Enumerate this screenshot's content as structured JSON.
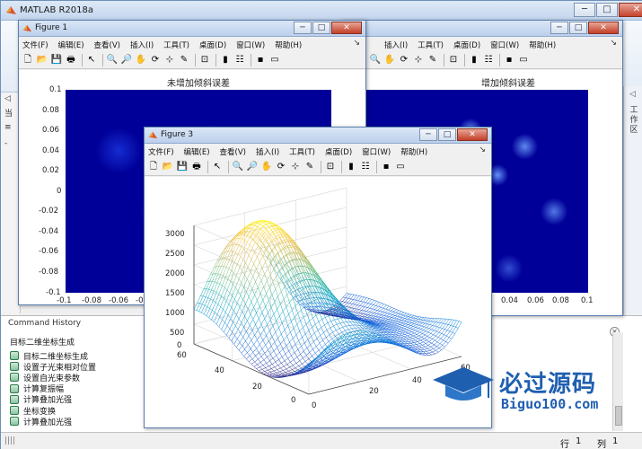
{
  "app": {
    "title": "MATLAB R2018a",
    "window_controls": {
      "minimize": "─",
      "maximize": "□",
      "close": "✕"
    }
  },
  "left_panel": {
    "glyphs": [
      "◁",
      "当",
      "≡",
      "-"
    ]
  },
  "right_panel": {
    "arrow": "◁",
    "label": "工作区"
  },
  "command_history": {
    "tab_label": "Command History",
    "close_glyph": "✕",
    "section_header": "目标二维坐标生成",
    "items": [
      "目标二维坐标生成",
      "设置子光束相对位置",
      "设置自光束参数",
      "计算复振幅",
      "计算叠加光强",
      "坐标变换",
      "计算叠加光强"
    ]
  },
  "status_bar": {
    "grip": "||||",
    "row_label": "行",
    "row_value": "1",
    "col_label": "列",
    "col_value": "1"
  },
  "figure_menu": [
    "文件(F)",
    "编辑(E)",
    "查看(V)",
    "插入(I)",
    "工具(T)",
    "桌面(D)",
    "窗口(W)",
    "帮助(H)"
  ],
  "figure_controls": {
    "minimize": "─",
    "maximize": "□",
    "close": "✕",
    "pin": "↘"
  },
  "figure1": {
    "title": "Figure 1",
    "axes_title": "未增加倾斜误差",
    "yticks": [
      "0.1",
      "0.08",
      "0.06",
      "0.04",
      "0.02",
      "0",
      "-0.02",
      "-0.04",
      "-0.06",
      "-0.08",
      "-0.1"
    ],
    "xticks": [
      "-0.1",
      "-0.08",
      "-0.06",
      "-0"
    ]
  },
  "figure2": {
    "axes_title": "增加倾斜误差",
    "xticks": [
      "0.04",
      "0.06",
      "0.08",
      "0.1"
    ]
  },
  "figure3": {
    "title": "Figure 3",
    "zticks": [
      "3000",
      "2500",
      "2000",
      "1500",
      "1000",
      "500",
      "0"
    ],
    "yticks": [
      "60",
      "40",
      "20",
      "0"
    ],
    "xticks": [
      "0",
      "20",
      "40",
      "60"
    ]
  },
  "chart_data": [
    {
      "type": "heatmap",
      "title": "未增加倾斜误差",
      "xlim": [
        -0.1,
        0.1
      ],
      "ylim": [
        -0.1,
        0.1
      ],
      "colormap": "parula"
    },
    {
      "type": "heatmap",
      "title": "增加倾斜误差",
      "xlim": [
        -0.1,
        0.1
      ],
      "ylim": [
        -0.1,
        0.1
      ],
      "colormap": "parula"
    },
    {
      "type": "mesh",
      "title": "",
      "xlim": [
        0,
        60
      ],
      "ylim": [
        0,
        60
      ],
      "zlim": [
        0,
        3000
      ],
      "colormap": "parula"
    }
  ],
  "watermark": {
    "cn": "必过源码",
    "en": "Biguo100.com"
  }
}
